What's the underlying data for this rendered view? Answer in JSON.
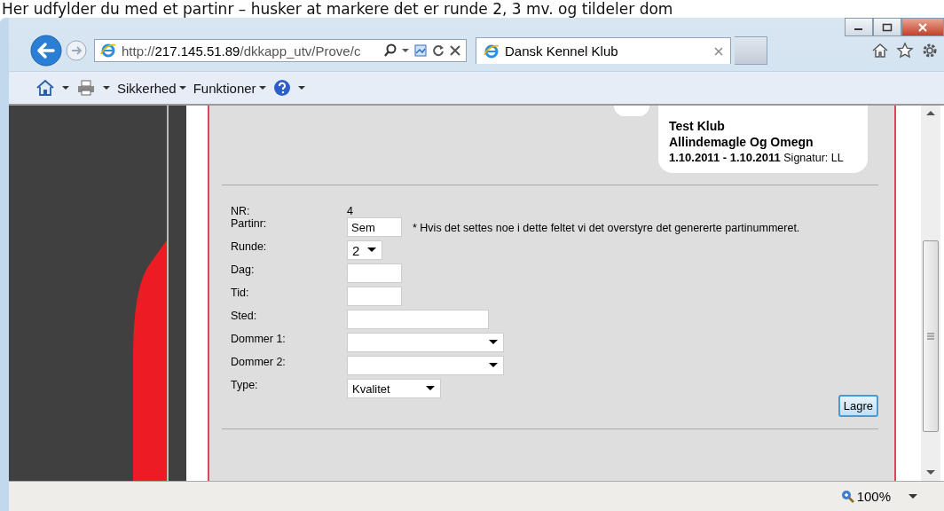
{
  "caption": "Her udfylder du med et partinr – husker at markere det er runde 2, 3 mv. og tildeler dom",
  "browser": {
    "address": {
      "scheme": "http://",
      "host": "217.145.51.89",
      "path": "/dkkapp_utv/Prove/c"
    },
    "tabs": [
      {
        "title": "Dansk Kennel Klub",
        "selected": true
      }
    ],
    "toolbar": [
      "Sikkerhed",
      "Funktioner"
    ],
    "zoom": "100%"
  },
  "card": {
    "lines": [
      "Test Klub",
      "Allindemagle Og Omegn"
    ],
    "dates": "1.10.2011 - 1.10.2011",
    "signature": "Signatur: LL"
  },
  "form": {
    "fields": [
      {
        "label": "NR:",
        "kind": "text",
        "value": "4"
      },
      {
        "label": "Partinr:",
        "kind": "short-input",
        "value": "Sem",
        "note": "* Hvis det settes noe i dette feltet vi det overstyre det genererte partinummeret."
      },
      {
        "label": "Runde:",
        "kind": "small-select",
        "value": "2"
      },
      {
        "label": "Dag:",
        "kind": "short-input"
      },
      {
        "label": "Tid:",
        "kind": "short-input"
      },
      {
        "label": "Sted:",
        "kind": "long-input"
      },
      {
        "label": "Dommer 1:",
        "kind": "wide-select"
      },
      {
        "label": "Dommer 2:",
        "kind": "wide-select"
      },
      {
        "label": "Type:",
        "kind": "medium-select",
        "value": "Kvalitet"
      }
    ],
    "save_button": "Lagre"
  }
}
